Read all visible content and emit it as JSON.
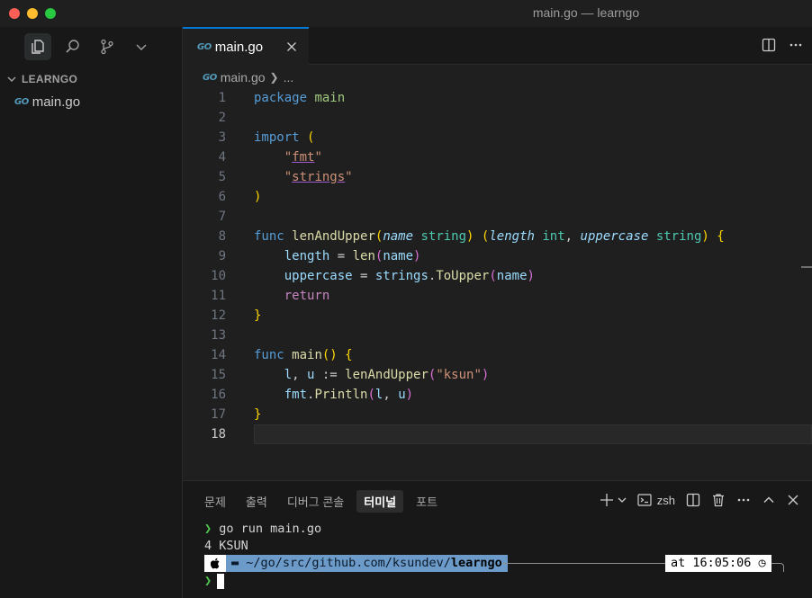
{
  "window": {
    "title": "main.go — learngo"
  },
  "sidebar": {
    "explorer_title": "LEARNGO",
    "files": [
      {
        "name": "main.go",
        "icon": "go-file-icon"
      }
    ]
  },
  "tabs": [
    {
      "label": "main.go",
      "icon_text": "GO",
      "active": true
    }
  ],
  "breadcrumb": {
    "file": "main.go",
    "rest": "..."
  },
  "editor": {
    "current_line": 18,
    "line_numbers": [
      "1",
      "2",
      "3",
      "4",
      "5",
      "6",
      "7",
      "8",
      "9",
      "10",
      "11",
      "12",
      "13",
      "14",
      "15",
      "16",
      "17",
      "18"
    ],
    "lines": [
      "package main",
      "",
      "import (",
      "    \"fmt\"",
      "    \"strings\"",
      ")",
      "",
      "func lenAndUpper(name string) (length int, uppercase string) {",
      "    length = len(name)",
      "    uppercase = strings.ToUpper(name)",
      "    return",
      "}",
      "",
      "func main() {",
      "    l, u := lenAndUpper(\"ksun\")",
      "    fmt.Println(l, u)",
      "}",
      ""
    ]
  },
  "panel": {
    "tabs": [
      "문제",
      "출력",
      "디버그 콘솔",
      "터미널",
      "포트"
    ],
    "active_tab": "터미널",
    "shell_label": "zsh",
    "terminal": {
      "command": "go run main.go",
      "output": "4 KSUN",
      "path_prefix": "~/go/src/github.com/ksundev/",
      "path_bold": "learngo",
      "time_label": "at 16:05:06"
    }
  },
  "colors": {
    "accent": "#0078d4",
    "editor_bg": "#1f1f1f",
    "sidebar_bg": "#181818",
    "prompt_green": "#4ec94e",
    "path_blue": "#6c9bc9"
  }
}
